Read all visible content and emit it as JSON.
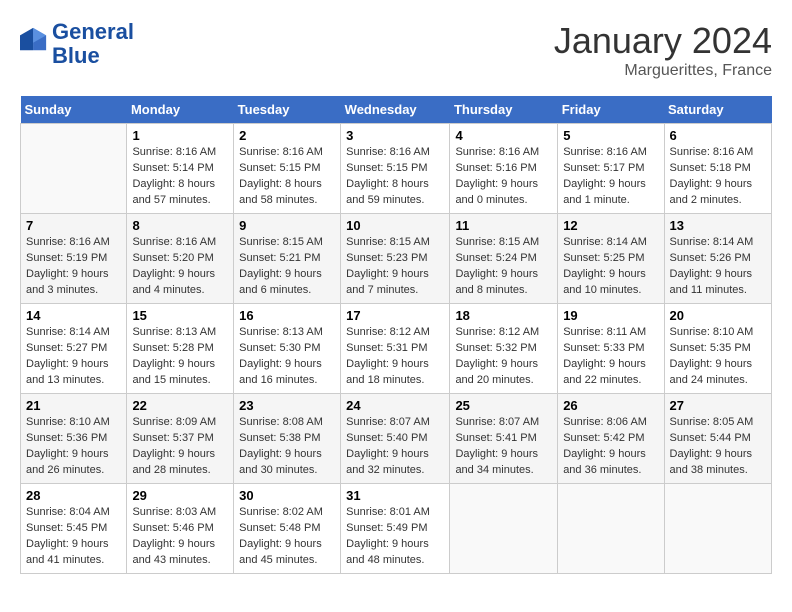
{
  "header": {
    "logo_line1": "General",
    "logo_line2": "Blue",
    "month": "January 2024",
    "location": "Marguerittes, France"
  },
  "columns": [
    "Sunday",
    "Monday",
    "Tuesday",
    "Wednesday",
    "Thursday",
    "Friday",
    "Saturday"
  ],
  "weeks": [
    [
      {
        "day": "",
        "info": ""
      },
      {
        "day": "1",
        "info": "Sunrise: 8:16 AM\nSunset: 5:14 PM\nDaylight: 8 hours\nand 57 minutes."
      },
      {
        "day": "2",
        "info": "Sunrise: 8:16 AM\nSunset: 5:15 PM\nDaylight: 8 hours\nand 58 minutes."
      },
      {
        "day": "3",
        "info": "Sunrise: 8:16 AM\nSunset: 5:15 PM\nDaylight: 8 hours\nand 59 minutes."
      },
      {
        "day": "4",
        "info": "Sunrise: 8:16 AM\nSunset: 5:16 PM\nDaylight: 9 hours\nand 0 minutes."
      },
      {
        "day": "5",
        "info": "Sunrise: 8:16 AM\nSunset: 5:17 PM\nDaylight: 9 hours\nand 1 minute."
      },
      {
        "day": "6",
        "info": "Sunrise: 8:16 AM\nSunset: 5:18 PM\nDaylight: 9 hours\nand 2 minutes."
      }
    ],
    [
      {
        "day": "7",
        "info": "Sunrise: 8:16 AM\nSunset: 5:19 PM\nDaylight: 9 hours\nand 3 minutes."
      },
      {
        "day": "8",
        "info": "Sunrise: 8:16 AM\nSunset: 5:20 PM\nDaylight: 9 hours\nand 4 minutes."
      },
      {
        "day": "9",
        "info": "Sunrise: 8:15 AM\nSunset: 5:21 PM\nDaylight: 9 hours\nand 6 minutes."
      },
      {
        "day": "10",
        "info": "Sunrise: 8:15 AM\nSunset: 5:23 PM\nDaylight: 9 hours\nand 7 minutes."
      },
      {
        "day": "11",
        "info": "Sunrise: 8:15 AM\nSunset: 5:24 PM\nDaylight: 9 hours\nand 8 minutes."
      },
      {
        "day": "12",
        "info": "Sunrise: 8:14 AM\nSunset: 5:25 PM\nDaylight: 9 hours\nand 10 minutes."
      },
      {
        "day": "13",
        "info": "Sunrise: 8:14 AM\nSunset: 5:26 PM\nDaylight: 9 hours\nand 11 minutes."
      }
    ],
    [
      {
        "day": "14",
        "info": "Sunrise: 8:14 AM\nSunset: 5:27 PM\nDaylight: 9 hours\nand 13 minutes."
      },
      {
        "day": "15",
        "info": "Sunrise: 8:13 AM\nSunset: 5:28 PM\nDaylight: 9 hours\nand 15 minutes."
      },
      {
        "day": "16",
        "info": "Sunrise: 8:13 AM\nSunset: 5:30 PM\nDaylight: 9 hours\nand 16 minutes."
      },
      {
        "day": "17",
        "info": "Sunrise: 8:12 AM\nSunset: 5:31 PM\nDaylight: 9 hours\nand 18 minutes."
      },
      {
        "day": "18",
        "info": "Sunrise: 8:12 AM\nSunset: 5:32 PM\nDaylight: 9 hours\nand 20 minutes."
      },
      {
        "day": "19",
        "info": "Sunrise: 8:11 AM\nSunset: 5:33 PM\nDaylight: 9 hours\nand 22 minutes."
      },
      {
        "day": "20",
        "info": "Sunrise: 8:10 AM\nSunset: 5:35 PM\nDaylight: 9 hours\nand 24 minutes."
      }
    ],
    [
      {
        "day": "21",
        "info": "Sunrise: 8:10 AM\nSunset: 5:36 PM\nDaylight: 9 hours\nand 26 minutes."
      },
      {
        "day": "22",
        "info": "Sunrise: 8:09 AM\nSunset: 5:37 PM\nDaylight: 9 hours\nand 28 minutes."
      },
      {
        "day": "23",
        "info": "Sunrise: 8:08 AM\nSunset: 5:38 PM\nDaylight: 9 hours\nand 30 minutes."
      },
      {
        "day": "24",
        "info": "Sunrise: 8:07 AM\nSunset: 5:40 PM\nDaylight: 9 hours\nand 32 minutes."
      },
      {
        "day": "25",
        "info": "Sunrise: 8:07 AM\nSunset: 5:41 PM\nDaylight: 9 hours\nand 34 minutes."
      },
      {
        "day": "26",
        "info": "Sunrise: 8:06 AM\nSunset: 5:42 PM\nDaylight: 9 hours\nand 36 minutes."
      },
      {
        "day": "27",
        "info": "Sunrise: 8:05 AM\nSunset: 5:44 PM\nDaylight: 9 hours\nand 38 minutes."
      }
    ],
    [
      {
        "day": "28",
        "info": "Sunrise: 8:04 AM\nSunset: 5:45 PM\nDaylight: 9 hours\nand 41 minutes."
      },
      {
        "day": "29",
        "info": "Sunrise: 8:03 AM\nSunset: 5:46 PM\nDaylight: 9 hours\nand 43 minutes."
      },
      {
        "day": "30",
        "info": "Sunrise: 8:02 AM\nSunset: 5:48 PM\nDaylight: 9 hours\nand 45 minutes."
      },
      {
        "day": "31",
        "info": "Sunrise: 8:01 AM\nSunset: 5:49 PM\nDaylight: 9 hours\nand 48 minutes."
      },
      {
        "day": "",
        "info": ""
      },
      {
        "day": "",
        "info": ""
      },
      {
        "day": "",
        "info": ""
      }
    ]
  ]
}
